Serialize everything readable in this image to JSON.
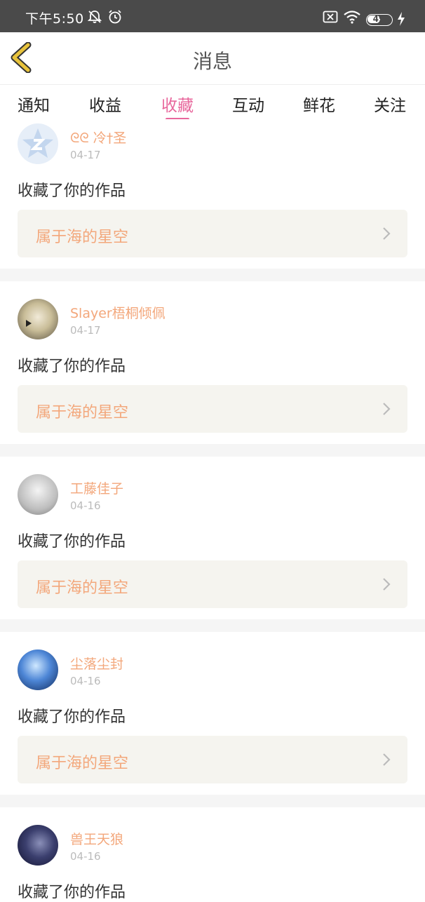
{
  "status_bar": {
    "time": "下午5:50",
    "battery": "49"
  },
  "header": {
    "title": "消息"
  },
  "tabs": [
    {
      "label": "通知"
    },
    {
      "label": "收益"
    },
    {
      "label": "收藏",
      "active": true
    },
    {
      "label": "互动"
    },
    {
      "label": "鲜花"
    },
    {
      "label": "关注"
    }
  ],
  "messages": [
    {
      "username": "ᘓᘓ 冷†圣",
      "date": "04-17",
      "action": "收藏了你的作品",
      "work_title": "属于海的星空"
    },
    {
      "username": "Slayer梧桐倾佩",
      "date": "04-17",
      "action": "收藏了你的作品",
      "work_title": "属于海的星空"
    },
    {
      "username": "工藤佳子",
      "date": "04-16",
      "action": "收藏了你的作品",
      "work_title": "属于海的星空"
    },
    {
      "username": "尘落尘封",
      "date": "04-16",
      "action": "收藏了你的作品",
      "work_title": "属于海的星空"
    },
    {
      "username": "兽王天狼",
      "date": "04-16",
      "action": "收藏了你的作品"
    }
  ],
  "colors": {
    "accent": "#e8679c",
    "username": "#f3a77b",
    "statusbar": "#4a4a4a",
    "work_bg": "#f5f4ef",
    "back_arrow": "#e8c33c"
  }
}
